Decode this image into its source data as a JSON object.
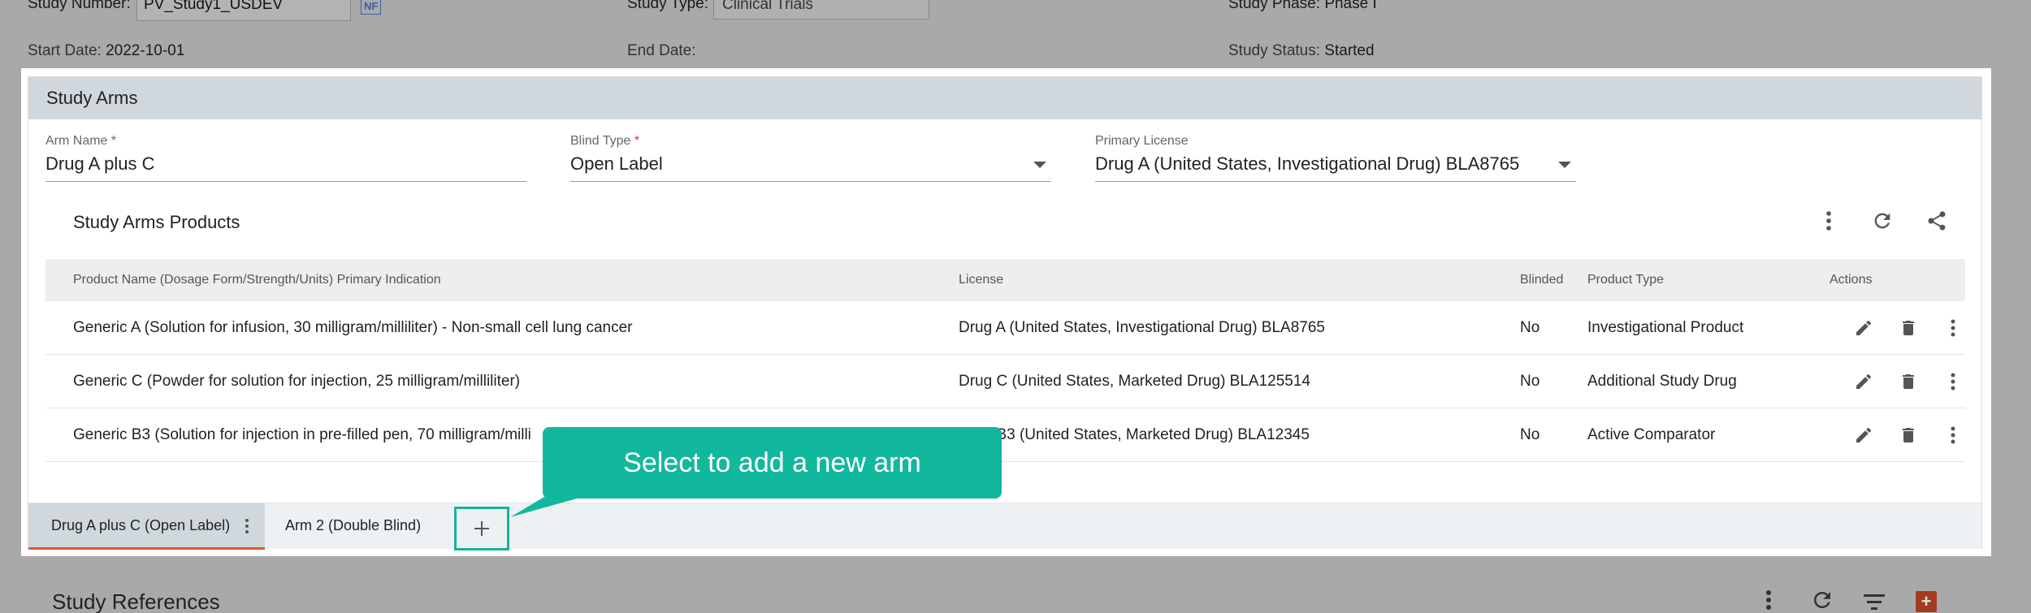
{
  "background": {
    "study_number_label": "Study Number:",
    "study_number_value": "PV_Study1_USDEV",
    "nf_badge": "NF",
    "study_type_label": "Study Type:",
    "study_type_value": "Clinical Trials",
    "study_phase_label": "Study Phase:",
    "study_phase_value": "Phase I",
    "start_date_label": "Start Date:",
    "start_date_value": "2022-10-01",
    "end_date_label": "End Date:",
    "end_date_value": "",
    "study_status_label": "Study Status:",
    "study_status_value": "Started",
    "references_heading": "Study References"
  },
  "panel": {
    "title": "Study Arms",
    "arm_name": {
      "label": "Arm Name",
      "required_mark": "*",
      "value": "Drug A plus C"
    },
    "blind_type": {
      "label": "Blind Type",
      "required_mark": "*",
      "value": "Open Label"
    },
    "primary_license": {
      "label": "Primary License",
      "value": "Drug A (United States, Investigational Drug) BLA8765"
    },
    "products_title": "Study Arms Products",
    "table": {
      "columns": {
        "product": "Product Name (Dosage Form/Strength/Units) Primary Indication",
        "license": "License",
        "blinded": "Blinded",
        "product_type": "Product Type",
        "actions": "Actions"
      },
      "rows": [
        {
          "product": "Generic A (Solution for infusion, 30 milligram/milliliter) - Non-small cell lung cancer",
          "license": "Drug A (United States, Investigational Drug) BLA8765",
          "blinded": "No",
          "product_type": "Investigational Product"
        },
        {
          "product": "Generic C (Powder for solution for injection, 25 milligram/milliliter)",
          "license": "Drug C (United States, Marketed Drug) BLA125514",
          "blinded": "No",
          "product_type": "Additional Study Drug"
        },
        {
          "product": "Generic B3 (Solution for injection in pre-filled pen, 70 milligram/milli",
          "license": "Drug B3 (United States, Marketed Drug) BLA12345",
          "blinded": "No",
          "product_type": "Active Comparator"
        }
      ]
    },
    "tabs": [
      {
        "label": "Drug A plus C (Open Label)",
        "active": true
      },
      {
        "label": "Arm 2 (Double Blind)",
        "active": false
      }
    ],
    "add_tab_symbol": "+"
  },
  "callout": {
    "text": "Select to add a new arm"
  },
  "colors": {
    "accent": "#12b89d",
    "tab_indicator": "#e25a2c",
    "required": "#d9381e",
    "header_bg": "#d0d8dd"
  },
  "icons": [
    "more-vert-icon",
    "refresh-icon",
    "share-icon",
    "edit-icon",
    "delete-icon",
    "plus-icon",
    "filter-icon"
  ]
}
